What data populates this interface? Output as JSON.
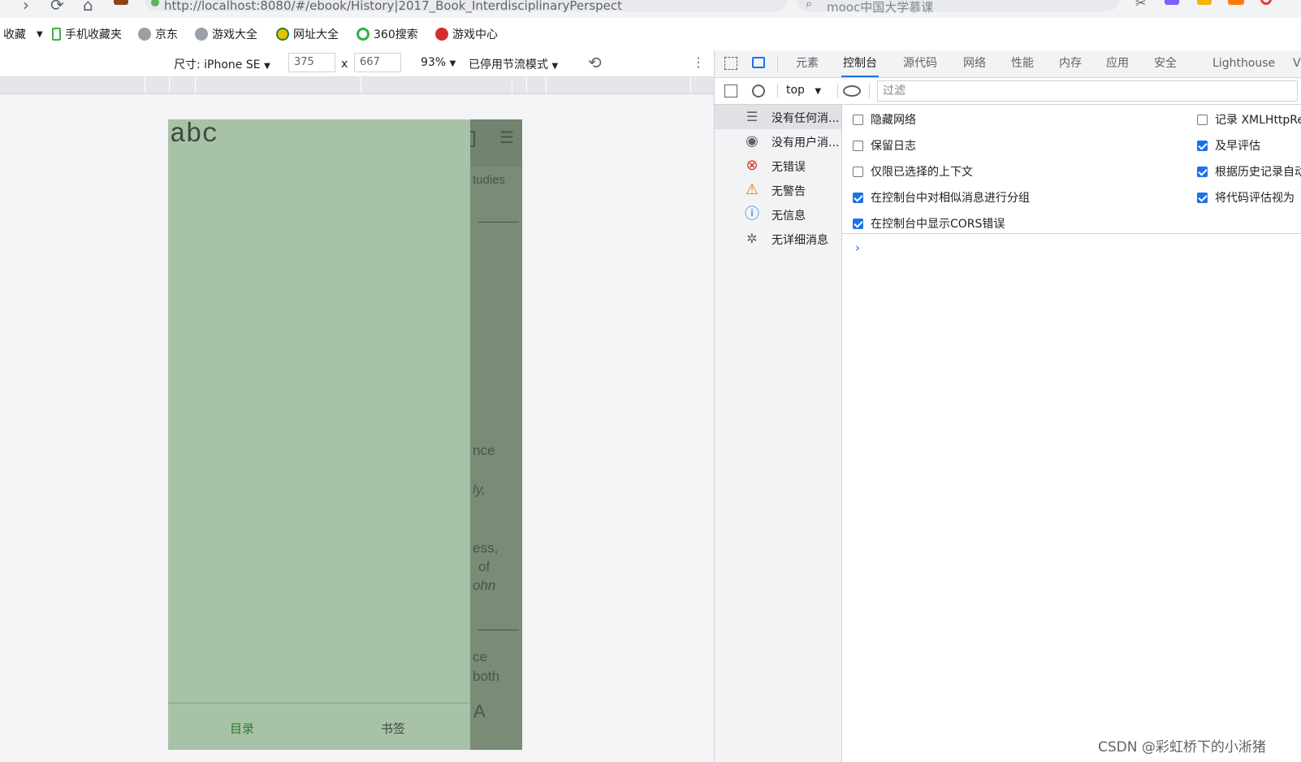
{
  "browser": {
    "address": "http://localhost:8080/#/ebook/History|2017_Book_InterdisciplinaryPerspect",
    "search_text": "mooc中国大学慕课"
  },
  "bookmarks": [
    {
      "label": "收藏",
      "icon": "dropdown-arrow-icon"
    },
    {
      "label": "手机收藏夹",
      "icon": "phone-icon"
    },
    {
      "label": "京东",
      "icon": "globe-icon"
    },
    {
      "label": "游戏大全",
      "icon": "globe-icon"
    },
    {
      "label": "网址大全",
      "icon": "plus-circle-icon"
    },
    {
      "label": "360搜索",
      "icon": "search-360-icon"
    },
    {
      "label": "游戏中心",
      "icon": "game-icon"
    }
  ],
  "device_toolbar": {
    "device": "尺寸: iPhone SE",
    "width": "375",
    "times": "x",
    "height": "667",
    "zoom": "93%",
    "throttle": "已停用节流模式"
  },
  "phone": {
    "drawer_title": "abc",
    "tabs": [
      "目录",
      "书签"
    ],
    "bg_fragments": [
      "tudies",
      "nce",
      "ly,",
      "ess,",
      "of",
      "ohn",
      "ce",
      "both",
      "A"
    ]
  },
  "devtools": {
    "tabs": [
      "元素",
      "控制台",
      "源代码",
      "网络",
      "性能",
      "内存",
      "应用",
      "安全",
      "Lighthouse",
      "V"
    ],
    "active_tab": "控制台",
    "context": "top",
    "filter_placeholder": "过滤",
    "sidebar": [
      {
        "label": "没有任何消...",
        "icon": "list-icon"
      },
      {
        "label": "没有用户消...",
        "icon": "user-icon"
      },
      {
        "label": "无错误",
        "icon": "error-icon"
      },
      {
        "label": "无警告",
        "icon": "warning-icon"
      },
      {
        "label": "无信息",
        "icon": "info-icon"
      },
      {
        "label": "无详细消息",
        "icon": "bug-icon"
      }
    ],
    "settings_left": [
      {
        "label": "隐藏网络",
        "checked": false
      },
      {
        "label": "保留日志",
        "checked": false
      },
      {
        "label": "仅限已选择的上下文",
        "checked": false
      },
      {
        "label": "在控制台中对相似消息进行分组",
        "checked": true
      },
      {
        "label": "在控制台中显示CORS错误",
        "checked": true
      }
    ],
    "settings_right": [
      {
        "label": "记录 XMLHttpRe",
        "checked": false
      },
      {
        "label": "及早评估",
        "checked": true
      },
      {
        "label": "根据历史记录自动",
        "checked": true
      },
      {
        "label": "将代码评估视为",
        "checked": true
      }
    ],
    "prompt": "›"
  },
  "watermark": "CSDN @彩虹桥下的小淅猪",
  "colors": {
    "drawer": "#a8c2a8",
    "phone_overlay": "#7a8b76",
    "accent": "#1a73e8",
    "active_tab_text": "#2e7d32"
  }
}
